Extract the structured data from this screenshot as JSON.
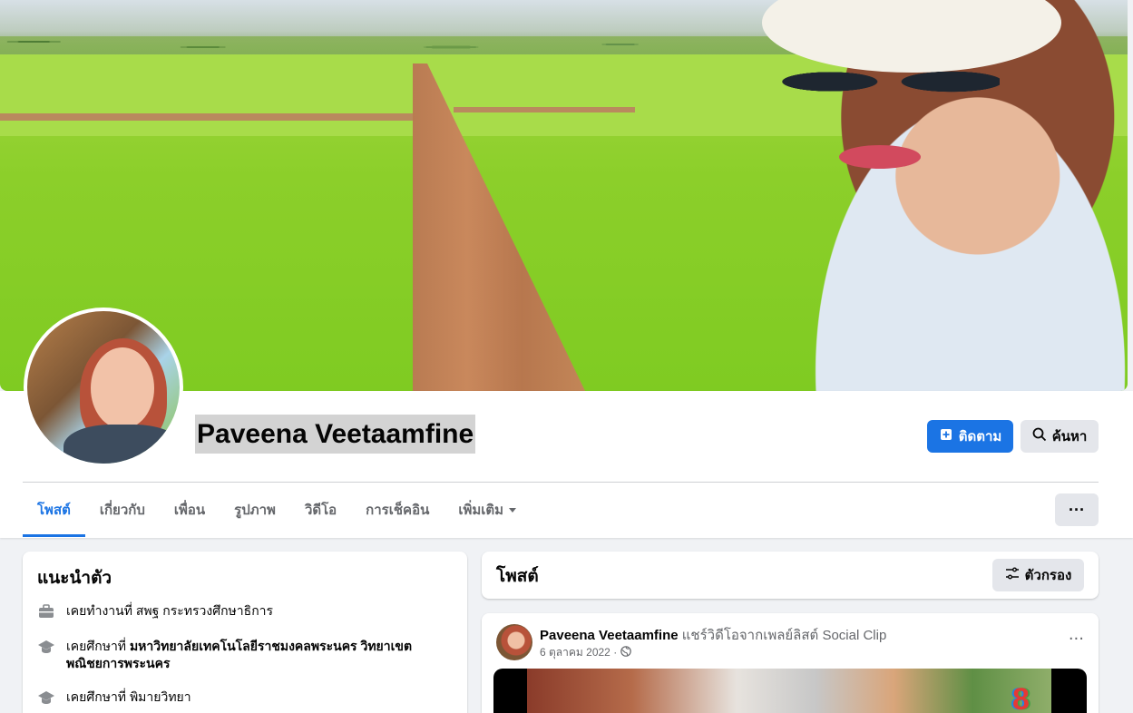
{
  "profile": {
    "name": "Paveena Veetaamfine"
  },
  "actions": {
    "follow_label": "ติดตาม",
    "search_label": "ค้นหา",
    "more_label": "···"
  },
  "tabs": [
    {
      "label": "โพสต์",
      "active": true
    },
    {
      "label": "เกี่ยวกับ"
    },
    {
      "label": "เพื่อน"
    },
    {
      "label": "รูปภาพ"
    },
    {
      "label": "วิดีโอ"
    },
    {
      "label": "การเช็คอิน"
    },
    {
      "label": "เพิ่มเติม"
    }
  ],
  "intro": {
    "title": "แนะนำตัว",
    "items": [
      {
        "icon": "briefcase-icon",
        "prefix": "เคยทำงานที่ ",
        "bold": "",
        "text": "สพฐ กระทรวงศึกษาธิการ"
      },
      {
        "icon": "graduation-cap-icon",
        "prefix": "เคยศึกษาที่ ",
        "bold": "มหาวิทยาลัยเทคโนโลยีราชมงคลพระนคร วิทยาเขตพณิชยการพระนคร",
        "text": ""
      },
      {
        "icon": "graduation-cap-icon",
        "prefix": "เคยศึกษาที่ ",
        "bold": "",
        "text": "พิมายวิทยา"
      }
    ]
  },
  "posts": {
    "title": "โพสต์",
    "filter_label": "ตัวกรอง",
    "first": {
      "author": "Paveena Veetaamfine",
      "action": " แชร์วิดีโอจากเพลย์ลิสต์ Social Clip",
      "date": "6 ตุลาคม 2022 ·",
      "privacy_icon": "globe-icon"
    }
  },
  "colors": {
    "accent": "#1b74e4",
    "background": "#f0f2f5",
    "secondary_button": "#e4e6eb"
  }
}
